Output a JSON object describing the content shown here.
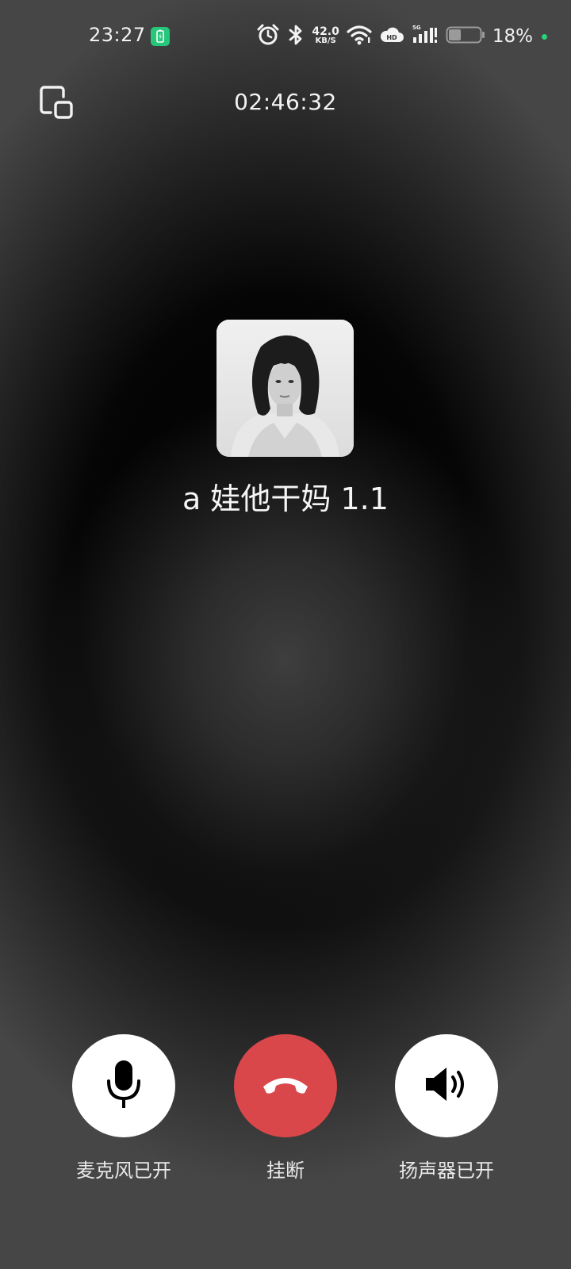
{
  "status_bar": {
    "time": "23:27",
    "net_speed_value": "42.0",
    "net_speed_unit": "KB/S",
    "battery_percent": "18%",
    "icons": [
      "battery-saver-icon",
      "alarm-icon",
      "bluetooth-icon",
      "wifi-icon",
      "hd-cloud-icon",
      "5g-signal-icon",
      "battery-icon"
    ],
    "battery_level": 0.18
  },
  "call": {
    "timer": "02:46:32",
    "caller_name": "a 娃他干妈 1.1"
  },
  "controls": {
    "mic_label": "麦克风已开",
    "hangup_label": "挂断",
    "speaker_label": "扬声器已开"
  },
  "colors": {
    "hangup": "#d9474a",
    "accent_green": "#27c77a"
  }
}
